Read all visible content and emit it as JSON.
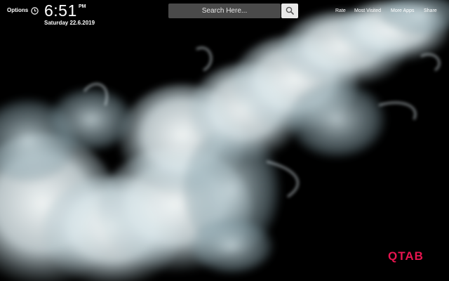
{
  "header": {
    "options_label": "Options",
    "clock_icon": "clock-icon",
    "time": "6:51",
    "ampm": "PM",
    "date": "Saturday  22.6.2019"
  },
  "search": {
    "placeholder": "Search Here...",
    "button_icon": "search-icon"
  },
  "nav": {
    "items": [
      {
        "label": "Rate"
      },
      {
        "label": "Most Visited"
      },
      {
        "label": "More Apps"
      },
      {
        "label": "Share"
      }
    ]
  },
  "brand": {
    "logo_text": "QTAB",
    "logo_color": "#e7144f"
  },
  "background": {
    "description_color": "#000000",
    "smoke_color": "#e4eef1"
  }
}
